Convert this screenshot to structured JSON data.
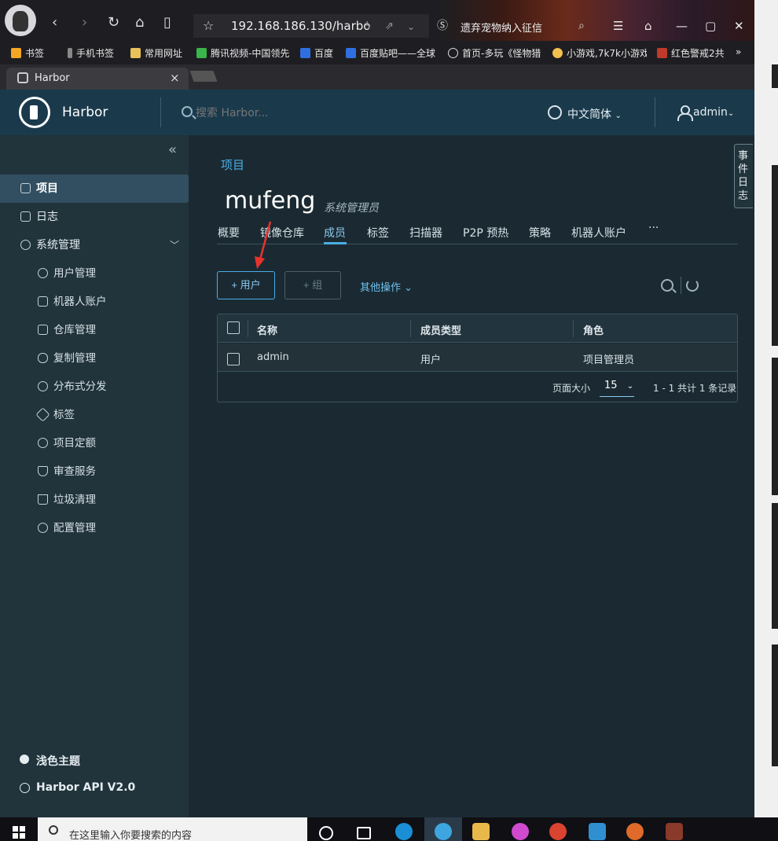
{
  "browser": {
    "url": "192.168.186.130/harbo",
    "ext_text": "遗弃宠物纳入征信",
    "bookmarks": [
      "书签",
      "手机书签",
      "常用网址",
      "腾讯视频-中国领先",
      "百度",
      "百度贴吧——全球",
      "首页-多玩《怪物猎",
      "小游戏,7k7k小游戏",
      "红色警戒2共"
    ],
    "tab_title": "Harbor"
  },
  "header": {
    "brand": "Harbor",
    "search_placeholder": "搜索 Harbor...",
    "language": "中文简体",
    "user": "admin"
  },
  "sidebar": {
    "items": [
      {
        "label": "项目",
        "icon": "project-icon",
        "active": true
      },
      {
        "label": "日志",
        "icon": "log-icon"
      },
      {
        "label": "系统管理",
        "icon": "admin-icon",
        "expandable": true
      }
    ],
    "sub_items": [
      {
        "label": "用户管理",
        "icon": "users-icon"
      },
      {
        "label": "机器人账户",
        "icon": "robot-icon"
      },
      {
        "label": "仓库管理",
        "icon": "box-icon"
      },
      {
        "label": "复制管理",
        "icon": "cloud-icon"
      },
      {
        "label": "分布式分发",
        "icon": "share-icon"
      },
      {
        "label": "标签",
        "icon": "tag-icon"
      },
      {
        "label": "项目定额",
        "icon": "quota-icon"
      },
      {
        "label": "审查服务",
        "icon": "shield-icon"
      },
      {
        "label": "垃圾清理",
        "icon": "trash-icon"
      },
      {
        "label": "配置管理",
        "icon": "gear-icon"
      }
    ],
    "theme": "浅色主题",
    "api": "Harbor API V2.0"
  },
  "main": {
    "breadcrumb": "项目",
    "project_name": "mufeng",
    "project_role": "系统管理员",
    "tabs": [
      "概要",
      "镜像仓库",
      "成员",
      "标签",
      "扫描器",
      "P2P 预热",
      "策略",
      "机器人账户",
      "···"
    ],
    "active_tab": "成员",
    "btn_add_user": "+ 用户",
    "btn_add_group": "+ 组",
    "more_ops": "其他操作 ⌄",
    "columns": [
      "名称",
      "成员类型",
      "角色"
    ],
    "rows": [
      {
        "name": "admin",
        "type": "用户",
        "role": "项目管理员"
      }
    ],
    "page_size_label": "页面大小",
    "page_size": "15",
    "page_info": "1 - 1 共计 1 条记录",
    "event_log": "事件日志"
  },
  "taskbar": {
    "search_text": "在这里输入你要搜索的内容"
  },
  "colors": {
    "accent": "#49aee5",
    "header_bg": "#1a3a4c",
    "sidebar_bg": "#21333b",
    "main_bg": "#1b2a32"
  }
}
